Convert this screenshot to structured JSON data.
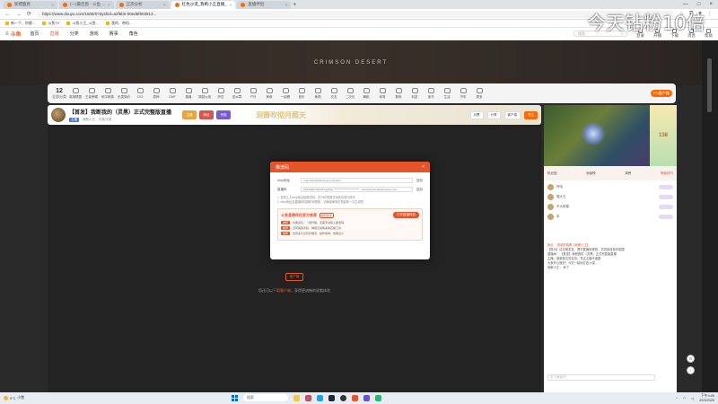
{
  "browser": {
    "tabs": [
      {
        "label": "新標籤頁"
      },
      {
        "label": "(一)最佳兽 - 斗鱼 ..."
      },
      {
        "label": "正宗分析"
      },
      {
        "label": "红色沙漠_我断小王直播_"
      },
      {
        "label": "直播伴侣"
      }
    ],
    "url": "https://www.douyu.com/1506/0?dyshid=a2f6b0-50ed5f803813...",
    "bookmarks": [
      "新一下、你都...",
      "斗鱼TV",
      "斗鱼小王_斗鱼...",
      "我的、带机..."
    ]
  },
  "header": {
    "logo": "斗鱼",
    "nav": [
      "首页",
      "直播",
      "分类",
      "游戏",
      "赛事",
      "角色"
    ],
    "search_placeholder": "搜索",
    "icons": [
      {
        "label": "登录"
      },
      {
        "label": "开播"
      },
      {
        "label": "下载"
      },
      {
        "label": "消息"
      },
      {
        "label": "帮助"
      }
    ]
  },
  "banner": {
    "text": "CRIMSON DESERT"
  },
  "categories": {
    "count": "12",
    "count_label": "全部分类",
    "items": [
      "英雄联盟",
      "王者荣耀",
      "和平精英",
      "无畏契约",
      "CS2",
      "原神",
      "DNF",
      "魔兽",
      "穿越火线",
      "炉石",
      "逆水寒",
      "户外",
      "美食",
      "一起看",
      "音乐",
      "鱼吧",
      "交友",
      "二次元",
      "舞蹈",
      "体育",
      "数码",
      "科技",
      "读书",
      "生活",
      "汽车",
      "更多"
    ],
    "pc_button": "PC客户端"
  },
  "room": {
    "title": "【首发】我断我的（灵黑）正式完整版直播",
    "tag": "主播",
    "meta": [
      "我断小王",
      "红色沙漠"
    ],
    "badges": [
      "主播",
      "粉丝",
      "贵族"
    ],
    "promo_text": "洞箫吹彻月照天",
    "actions": [
      "月票",
      "分享",
      "客户端",
      "关注"
    ]
  },
  "player": {
    "download_btn": "客户端",
    "tip_prefix": "您还可以",
    "tip_link": "下载客户端",
    "tip_suffix": "，获得更流畅的观看体验"
  },
  "modal": {
    "title": "推流码",
    "rtmp_label": "rtmp地址",
    "rtmp_value": "rtmp://sendtc3a.douyu.com/live",
    "key_label": "直播码",
    "key_value": "1506180ru8pFZtT4pPDu ************************ ...&txhost=sendtc3a.douyu.com",
    "copy": "复制",
    "note1": "1. 复制上方rtmp地址及推流码，在OBS的推流设置中进行填写",
    "note2": "2. rtmp地址及直播码将随时间更新，请确保使用的是最新一次生成的",
    "promo_title": "斗鱼直播伴侣官方推荐",
    "promo_tag": "推荐使用",
    "open_btn": "打开直播伴侣",
    "rows": [
      {
        "k": "推荐",
        "v": "功能完善，一键开播，无需手动输入推流码"
      },
      {
        "k": "推荐",
        "v": "自带美颜滤镜、弹幕互动等多种直播工具"
      },
      {
        "k": "推荐",
        "v": "支持多平台同步推流，操作简单，效果出众"
      }
    ]
  },
  "side": {
    "ad_text": "138",
    "tabs": [
      "粉丝团",
      "贡献榜",
      "周榜",
      "等级排行"
    ],
    "rank_tab": "等级排行",
    "list": [
      {
        "name": "哼哈"
      },
      {
        "name": "喂大王"
      },
      {
        "name": "不大佬猫"
      },
      {
        "name": "本"
      }
    ],
    "chat": [
      "鱼丸 ：感谢您观看【我断小王】",
      "【提示】请文明发言，遵守直播间规则，共同营造良好氛围",
      "直播间 ：【首发】我断我的（灵黑）正式完整版直播",
      "主播：感谢各位的支持，关注主播不迷路",
      "大家开心就好！今天一起玩红色沙漠",
      "我断小王 ：来了"
    ],
    "input_placeholder": "发个弹幕吧"
  },
  "overlay_text": "今天钻粉10倍",
  "taskbar": {
    "weather_temp": "6°C",
    "weather_desc": "小雪",
    "search": "搜索",
    "time": "下午4:09",
    "date": "29/3/2026"
  }
}
